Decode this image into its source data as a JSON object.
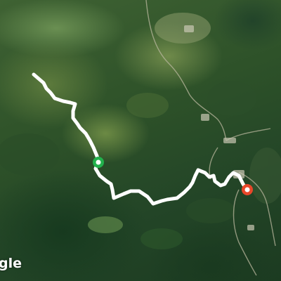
{
  "map": {
    "type": "satellite",
    "attribution": "gle",
    "route": {
      "color": "#ffffff",
      "start_marker_color": "#22b14c",
      "end_marker_color": "#e8472a"
    }
  }
}
